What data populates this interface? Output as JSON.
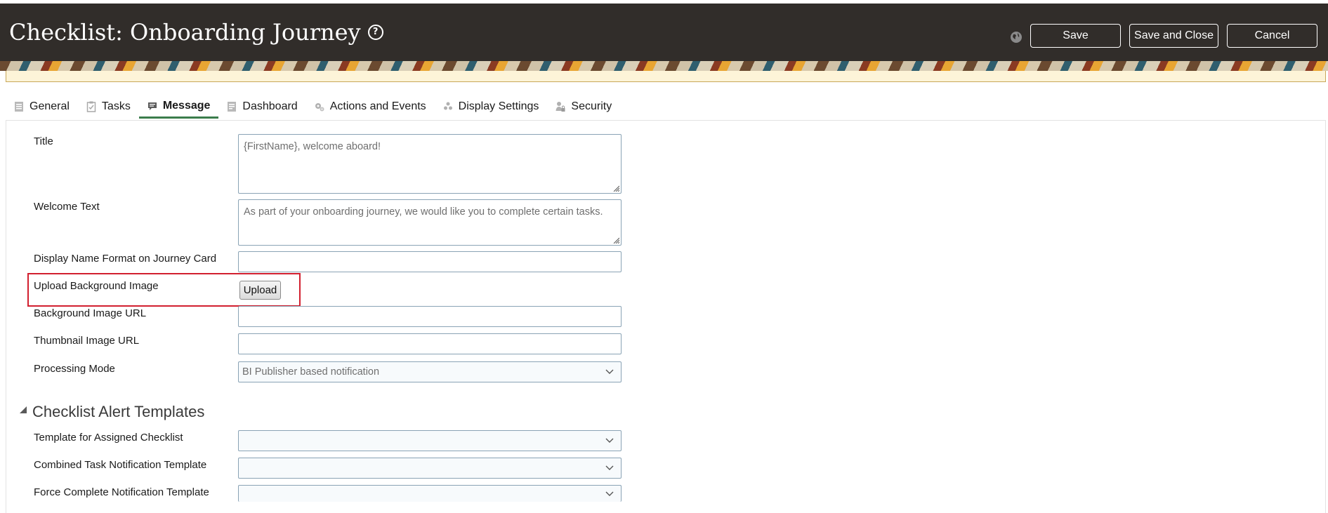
{
  "header": {
    "title": "Checklist: Onboarding Journey",
    "help_icon": "?",
    "buttons": {
      "save": "Save",
      "save_and_close": "Save and Close",
      "cancel": "Cancel"
    }
  },
  "tabs": [
    {
      "label": "General",
      "icon": "document-icon"
    },
    {
      "label": "Tasks",
      "icon": "clipboard-icon"
    },
    {
      "label": "Message",
      "icon": "chat-icon",
      "active": true
    },
    {
      "label": "Dashboard",
      "icon": "report-icon"
    },
    {
      "label": "Actions and Events",
      "icon": "gears-icon"
    },
    {
      "label": "Display Settings",
      "icon": "people-icon"
    },
    {
      "label": "Security",
      "icon": "user-lock-icon"
    }
  ],
  "form": {
    "title": {
      "label": "Title",
      "value": "{FirstName}, welcome aboard!"
    },
    "welcome_text": {
      "label": "Welcome Text",
      "value": "As part of your onboarding journey, we would like you to complete certain tasks."
    },
    "display_name_format": {
      "label": "Display Name Format on Journey Card",
      "value": ""
    },
    "upload_background": {
      "label": "Upload Background Image",
      "button": "Upload"
    },
    "background_image_url": {
      "label": "Background Image URL",
      "value": ""
    },
    "thumbnail_image_url": {
      "label": "Thumbnail Image URL",
      "value": ""
    },
    "processing_mode": {
      "label": "Processing Mode",
      "value": "BI Publisher based notification"
    }
  },
  "alert_templates": {
    "title": "Checklist Alert Templates",
    "assigned_checklist": {
      "label": "Template for Assigned Checklist",
      "value": ""
    },
    "combined_task": {
      "label": "Combined Task Notification Template",
      "value": ""
    },
    "force_complete": {
      "label": "Force Complete Notification Template",
      "value": ""
    }
  },
  "colors": {
    "header_bg": "#312d2a",
    "active_tab_underline": "#3b7d4c",
    "highlight": "#d21f2f"
  }
}
